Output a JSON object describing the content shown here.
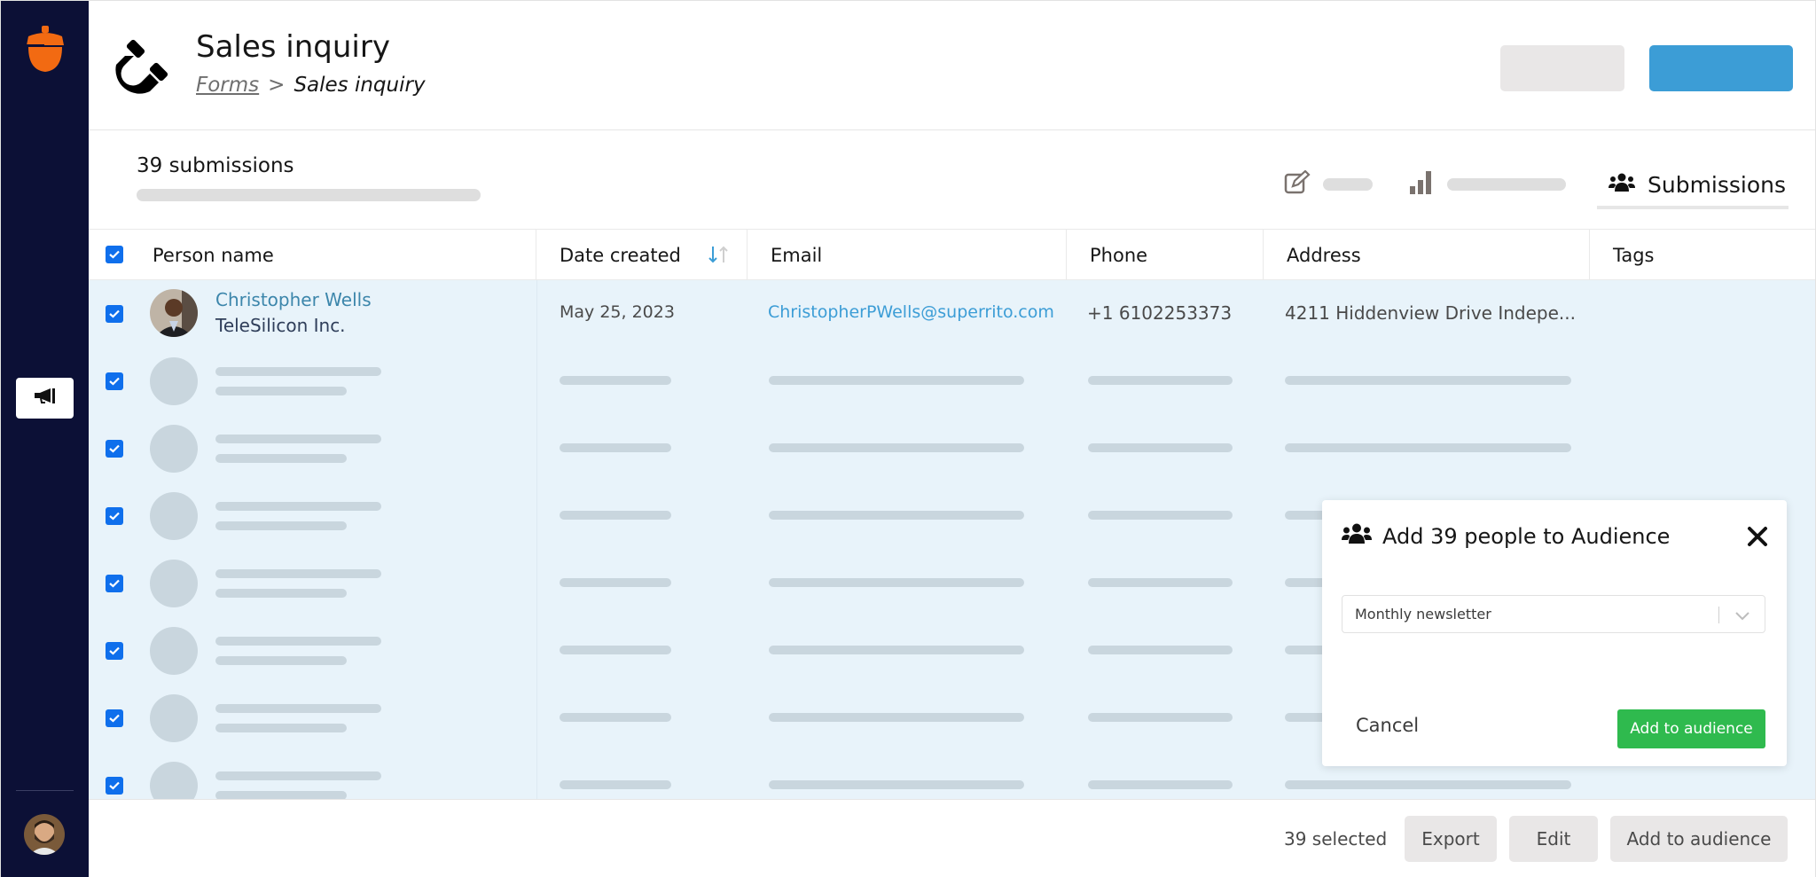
{
  "sidebar": {
    "logo_icon": "acorn-logo-icon",
    "nav_items": [
      {
        "icon": "megaphone-icon",
        "active": true
      }
    ],
    "user_avatar": "user-avatar"
  },
  "header": {
    "title": "Sales inquiry",
    "form_icon": "magnet-icon",
    "breadcrumb": {
      "parent": "Forms",
      "separator": ">",
      "current": "Sales inquiry"
    },
    "secondary_button_label": "",
    "primary_button_label": ""
  },
  "subheader": {
    "submission_count": "39 submissions",
    "tabs": [
      {
        "icon": "edit-icon",
        "label": "",
        "active": false
      },
      {
        "icon": "bar-chart-icon",
        "label": "",
        "active": false
      },
      {
        "icon": "users-icon",
        "label": "Submissions",
        "active": true
      }
    ]
  },
  "table": {
    "columns": [
      "Person name",
      "Date created",
      "Email",
      "Phone",
      "Address",
      "Tags"
    ],
    "sort": {
      "column": "Date created",
      "direction": "descending"
    },
    "all_selected": true,
    "rows": [
      {
        "selected": true,
        "name": "Christopher Wells",
        "company": "TeleSilicon Inc.",
        "date": "May 25, 2023",
        "email": "ChristopherPWells@superrito.com",
        "phone": "+1 6102253373",
        "address": "4211 Hiddenview Drive Indepe...",
        "tags": ""
      }
    ],
    "loading_rows": 7
  },
  "footer": {
    "selected_count": "39 selected",
    "buttons": [
      "Export",
      "Edit",
      "Add to audience"
    ]
  },
  "modal": {
    "icon": "users-icon",
    "title": "Add 39 people to Audience",
    "select_value": "Monthly newsletter",
    "cancel_label": "Cancel",
    "confirm_label": "Add to audience"
  },
  "colors": {
    "sidebar_bg": "#0c1036",
    "logo": "#f26a12",
    "primary": "#3c9dd6",
    "checkbox": "#0f6fec",
    "link": "#3c86ab",
    "row_selected_bg": "#e8f3fa",
    "confirm_green": "#2fba4e"
  }
}
